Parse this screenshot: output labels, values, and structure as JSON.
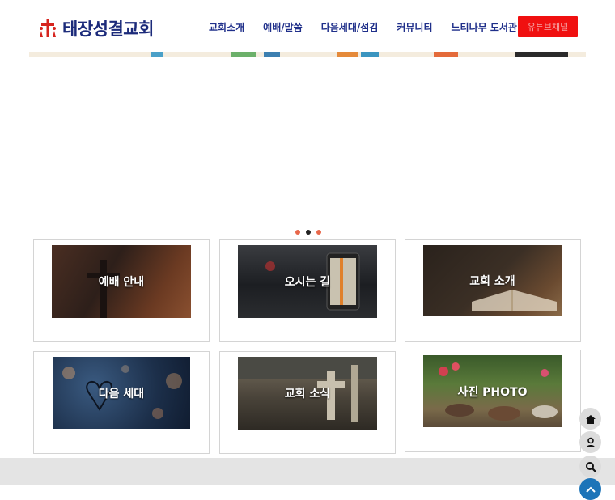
{
  "header": {
    "logo_text": "태장성결교회",
    "nav": [
      "교회소개",
      "예배/말씀",
      "다음세대/섬김",
      "커뮤니티",
      "느티나무 도서관"
    ],
    "youtube_label": "유튜브채널"
  },
  "slider": {
    "dot_count": 3,
    "active_dot": 1,
    "dot_color": "#e8674a",
    "active_color": "#222222"
  },
  "cards": [
    {
      "label": "예배 안내"
    },
    {
      "label": "오시는 길"
    },
    {
      "label": "교회 소개"
    },
    {
      "label": "다음 세대"
    },
    {
      "label": "교회 소식"
    },
    {
      "label": "사진 PHOTO"
    }
  ],
  "floating_buttons": [
    "home-icon",
    "user-icon",
    "search-icon",
    "top-icon"
  ],
  "colors": {
    "accent": "#1f2f8a",
    "youtube": "#f01010",
    "logo_red": "#d6241e"
  }
}
